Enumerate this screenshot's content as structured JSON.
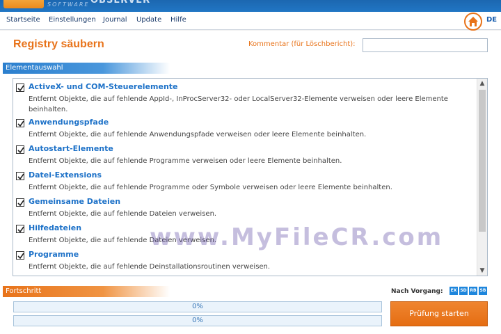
{
  "app": {
    "logo_main": "OBSERVER",
    "logo_sub": "SOFTWARE"
  },
  "menu": {
    "items": [
      "Startseite",
      "Einstellungen",
      "Journal",
      "Update",
      "Hilfe"
    ],
    "language": "DE",
    "home_icon": "home-icon"
  },
  "header": {
    "title": "Registry säubern",
    "comment_label": "Kommentar (für Löschbericht):",
    "comment_value": ""
  },
  "element_section": {
    "label": "Elementauswahl",
    "items": [
      {
        "title": "ActiveX- und COM-Steuerelemente",
        "desc": "Entfernt Objekte, die auf fehlende AppId-, InProcServer32- oder LocalServer32-Elemente verweisen oder leere Elemente beinhalten.",
        "checked": true
      },
      {
        "title": "Anwendungspfade",
        "desc": "Entfernt Objekte, die auf fehlende Anwendungspfade verweisen oder leere Elemente beinhalten.",
        "checked": true
      },
      {
        "title": "Autostart-Elemente",
        "desc": "Entfernt Objekte, die auf fehlende Programme verweisen oder leere Elemente beinhalten.",
        "checked": true
      },
      {
        "title": "Datei-Extensions",
        "desc": "Entfernt Objekte, die auf fehlende Programme oder Symbole verweisen oder leere Elemente beinhalten.",
        "checked": true
      },
      {
        "title": "Gemeinsame Dateien",
        "desc": "Entfernt Objekte, die auf fehlende Dateien verweisen.",
        "checked": true
      },
      {
        "title": "Hilfedateien",
        "desc": "Entfernt Objekte, die auf fehlende Dateien verweisen.",
        "checked": true
      },
      {
        "title": "Programme",
        "desc": "Entfernt Objekte, die auf fehlende Deinstallationsroutinen verweisen.",
        "checked": true
      }
    ]
  },
  "watermark": "www.MyFileCR.com",
  "progress_section": {
    "label": "Fortschritt",
    "bars": [
      {
        "text": "0%",
        "value": 0
      },
      {
        "text": "0%",
        "value": 0
      }
    ]
  },
  "after_action": {
    "label": "Nach Vorgang:",
    "badges": [
      "EX",
      "SD",
      "RB",
      "SB"
    ]
  },
  "start_button": "Prüfung starten",
  "colors": {
    "accent_orange": "#e8731a",
    "title_blue": "#1e72c8",
    "bar_blue": "#2b7fce"
  }
}
